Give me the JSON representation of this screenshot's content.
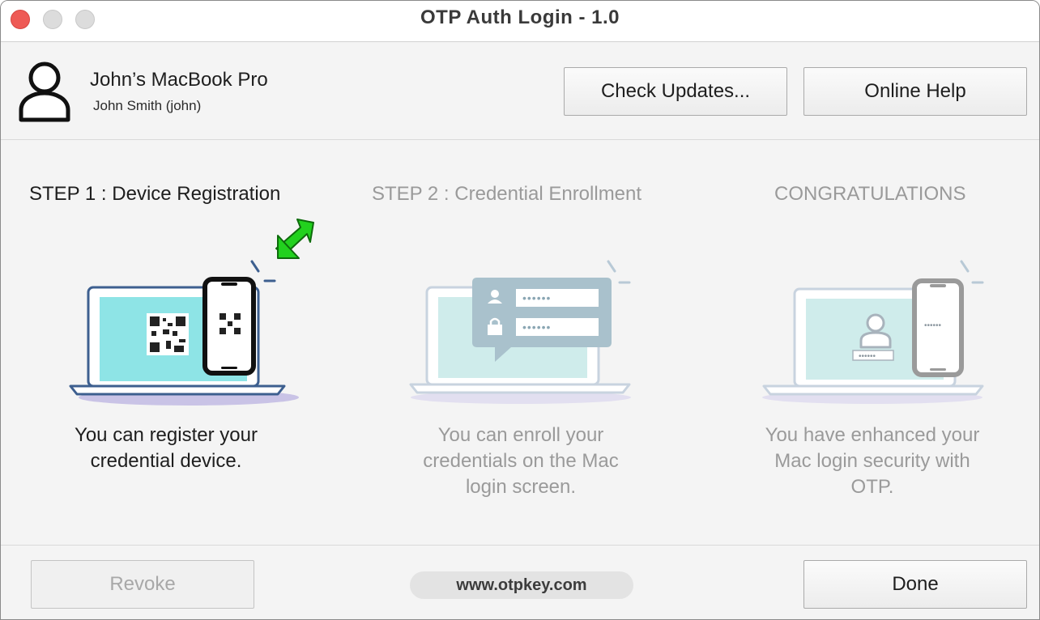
{
  "window": {
    "title": "OTP Auth Login - 1.0"
  },
  "account": {
    "host": "John’s MacBook Pro",
    "user": "John Smith (john)"
  },
  "header": {
    "check_updates_label": "Check Updates...",
    "online_help_label": "Online Help"
  },
  "steps": [
    {
      "title": "STEP 1 : Device Registration",
      "desc_line1": "You can register your",
      "desc_line2": "credential device.",
      "desc_line3": "",
      "active": true
    },
    {
      "title": "STEP 2 : Credential Enrollment",
      "desc_line1": "You can enroll your",
      "desc_line2": "credentials on the Mac",
      "desc_line3": "login screen.",
      "active": false
    },
    {
      "title": "CONGRATULATIONS",
      "desc_line1": "You have enhanced your",
      "desc_line2": "Mac login security with",
      "desc_line3": "OTP.",
      "active": false
    }
  ],
  "illustration_text": {
    "password_mask": "••••••"
  },
  "footer": {
    "revoke_label": "Revoke",
    "url": "www.otpkey.com",
    "done_label": "Done"
  },
  "colors": {
    "close": "#ee5a55",
    "screen_active": "#8ee4e6",
    "screen_inactive": "#cfeceb",
    "arrow": "#22d11e",
    "laptop_outline": "#3d5f8f"
  },
  "icons": [
    "user-icon",
    "green-arrow-icon",
    "qr-code-icon",
    "phone-icon",
    "laptop-icon",
    "lock-icon",
    "chat-bubble-icon"
  ]
}
